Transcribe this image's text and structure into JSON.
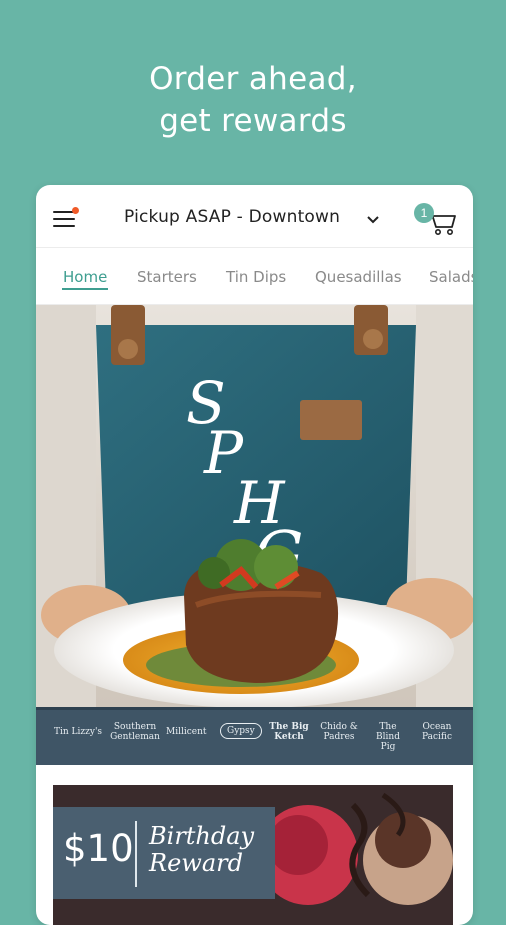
{
  "promo": {
    "line1": "Order ahead,",
    "line2": "get rewards"
  },
  "header": {
    "location": "Pickup ASAP - Downtown",
    "cart_count": "1"
  },
  "tabs": [
    {
      "label": "Home",
      "active": true
    },
    {
      "label": "Starters"
    },
    {
      "label": "Tin Dips"
    },
    {
      "label": "Quesadillas"
    },
    {
      "label": "Salads"
    }
  ],
  "hero": {
    "logo_text": "SPHG"
  },
  "brands": [
    "Tin Lizzy's",
    "Southern Gentleman",
    "Millicent",
    "Gypsy",
    "The Big Ketch",
    "Chido & Padres",
    "The Blind Pig",
    "Ocean Pacific"
  ],
  "reward": {
    "amount": "$10",
    "title": "Birthday Reward"
  },
  "colors": {
    "background": "#68b5a6",
    "accent": "#3e9e90",
    "notification": "#f05a28",
    "brand_bar": "#3f5566"
  }
}
